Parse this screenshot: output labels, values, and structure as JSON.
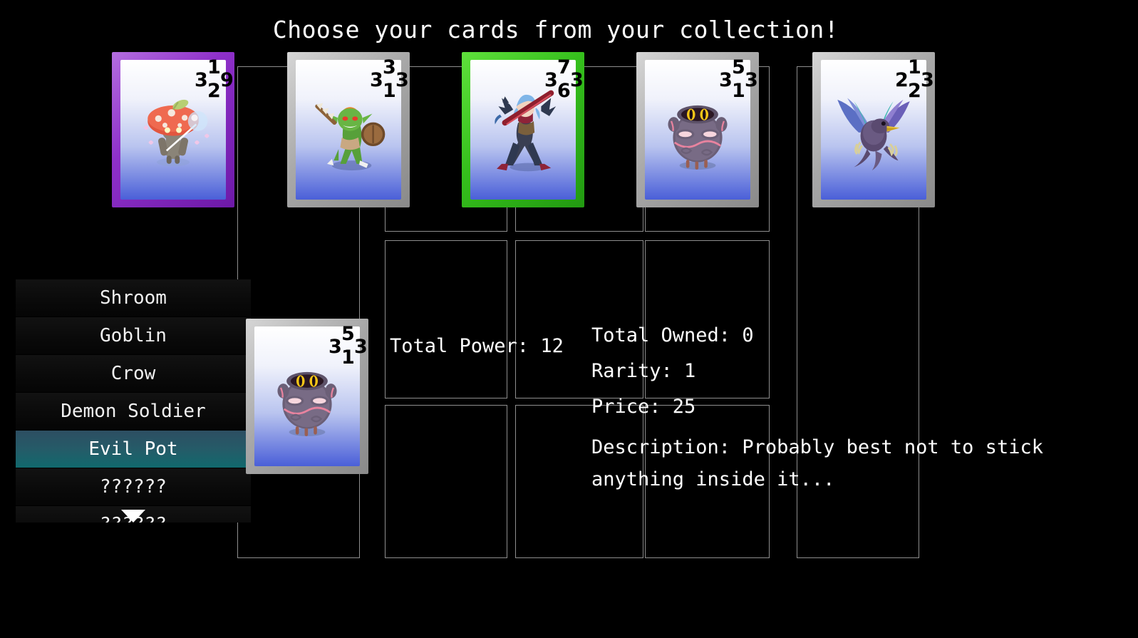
{
  "screen": {
    "title": "Choose your cards from your collection!",
    "background": "#000000"
  },
  "hand": {
    "cards": [
      {
        "name": "Shroom",
        "border_color": "#9b3fd1",
        "stats": {
          "top": "1",
          "left": "3",
          "right": "9",
          "bottom": "2"
        },
        "art": "mushroom-creature"
      },
      {
        "name": "Goblin",
        "border_color": "#a9a9a9",
        "stats": {
          "top": "3",
          "left": "3",
          "right": "3",
          "bottom": "1"
        },
        "art": "goblin-warrior"
      },
      {
        "name": "Demon Soldier",
        "border_color": "#3fc422",
        "stats": {
          "top": "7",
          "left": "3",
          "right": "3",
          "bottom": "6"
        },
        "art": "demon-soldier"
      },
      {
        "name": "Evil Pot",
        "border_color": "#a9a9a9",
        "stats": {
          "top": "5",
          "left": "3",
          "right": "3",
          "bottom": "1"
        },
        "art": "evil-pot"
      },
      {
        "name": "Crow",
        "border_color": "#a9a9a9",
        "stats": {
          "top": "1",
          "left": "2",
          "right": "3",
          "bottom": "2"
        },
        "art": "crow-bird"
      }
    ]
  },
  "collection_list": {
    "items": [
      {
        "label": "Shroom",
        "selected": false
      },
      {
        "label": "Goblin",
        "selected": false
      },
      {
        "label": "Crow",
        "selected": false
      },
      {
        "label": "Demon Soldier",
        "selected": false
      },
      {
        "label": "Evil Pot",
        "selected": true
      },
      {
        "label": "??????",
        "selected": false
      },
      {
        "label": "??????",
        "selected": false
      }
    ],
    "scroll_indicator": "scroll-down-arrow",
    "selected_color": "#1a6b6d"
  },
  "preview": {
    "card": {
      "name": "Evil Pot",
      "border_color": "#a9a9a9",
      "stats": {
        "top": "5",
        "left": "3",
        "right": "3",
        "bottom": "1"
      },
      "art": "evil-pot"
    }
  },
  "stats_panel": {
    "total_power": "Total Power: 12",
    "total_owned": "Total Owned: 0",
    "rarity": "Rarity: 1",
    "price": "Price: 25",
    "description_line1": "Description: Probably best not to stick",
    "description_line2": "anything inside it..."
  }
}
